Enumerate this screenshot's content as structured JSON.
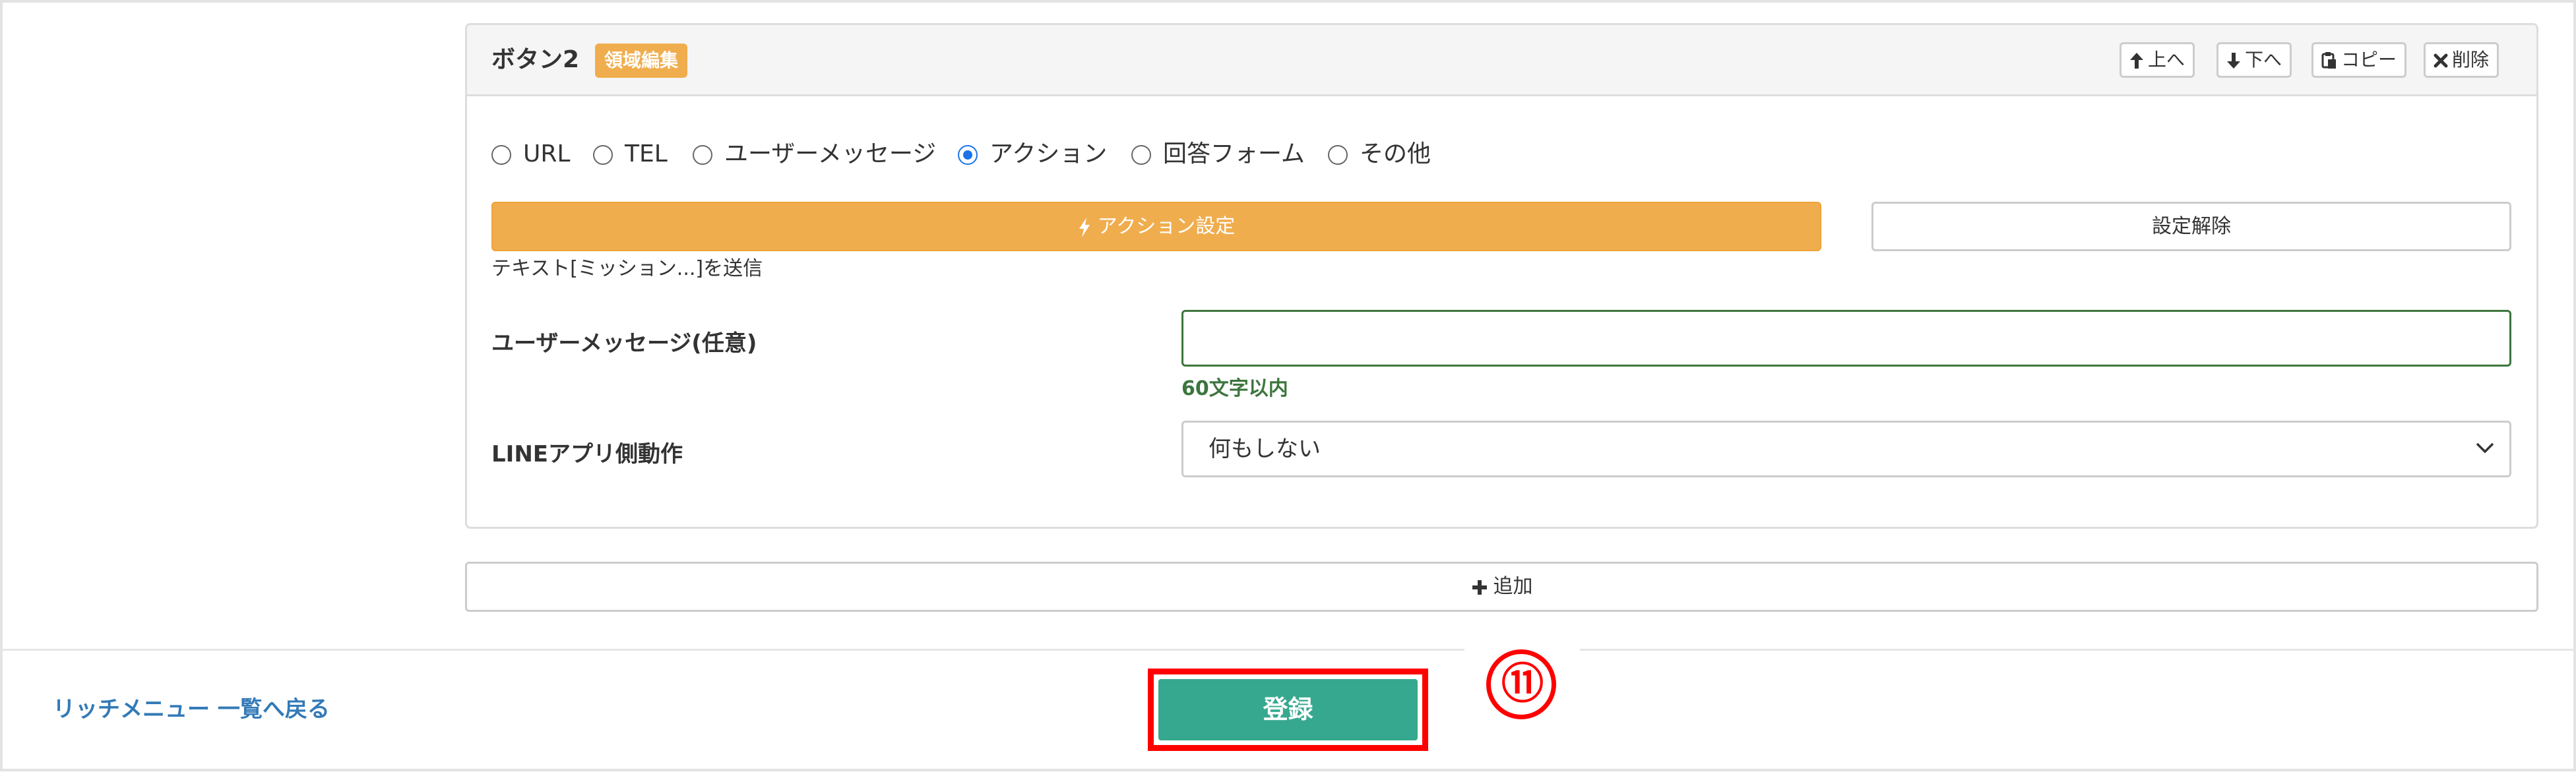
{
  "panel": {
    "title": "ボタン2",
    "badge": "領域編集",
    "toolbar": {
      "up_label": "上へ",
      "down_label": "下へ",
      "copy_label": "コピー",
      "delete_label": "削除"
    }
  },
  "action_type": {
    "options": [
      {
        "label": "URL",
        "selected": false
      },
      {
        "label": "TEL",
        "selected": false
      },
      {
        "label": "ユーザーメッセージ",
        "selected": false
      },
      {
        "label": "アクション",
        "selected": true
      },
      {
        "label": "回答フォーム",
        "selected": false
      },
      {
        "label": "その他",
        "selected": false
      }
    ]
  },
  "action": {
    "settings_label": "アクション設定",
    "clear_label": "設定解除",
    "summary": "テキスト[ミッション...]を送信"
  },
  "user_message": {
    "label": "ユーザーメッセージ(任意)",
    "value": "",
    "hint": "60文字以内"
  },
  "line_app": {
    "label": "LINEアプリ側動作",
    "selected": "何もしない"
  },
  "add_label": "追加",
  "footer": {
    "back_link": "リッチメニュー 一覧へ戻る",
    "register_label": "登録",
    "step_marker": "⑪"
  },
  "colors": {
    "accent_orange": "#f0ad4e",
    "register_green": "#36a88f",
    "highlight_red": "#ff0000",
    "link_blue": "#337ab7",
    "hint_green": "#3c763d",
    "radio_blue": "#1a73e8"
  },
  "icons": {
    "up": "arrow-up-icon",
    "down": "arrow-down-icon",
    "copy": "clipboard-icon",
    "delete": "close-icon",
    "action": "bolt-icon",
    "add": "plus-icon",
    "select": "chevron-down-icon"
  }
}
